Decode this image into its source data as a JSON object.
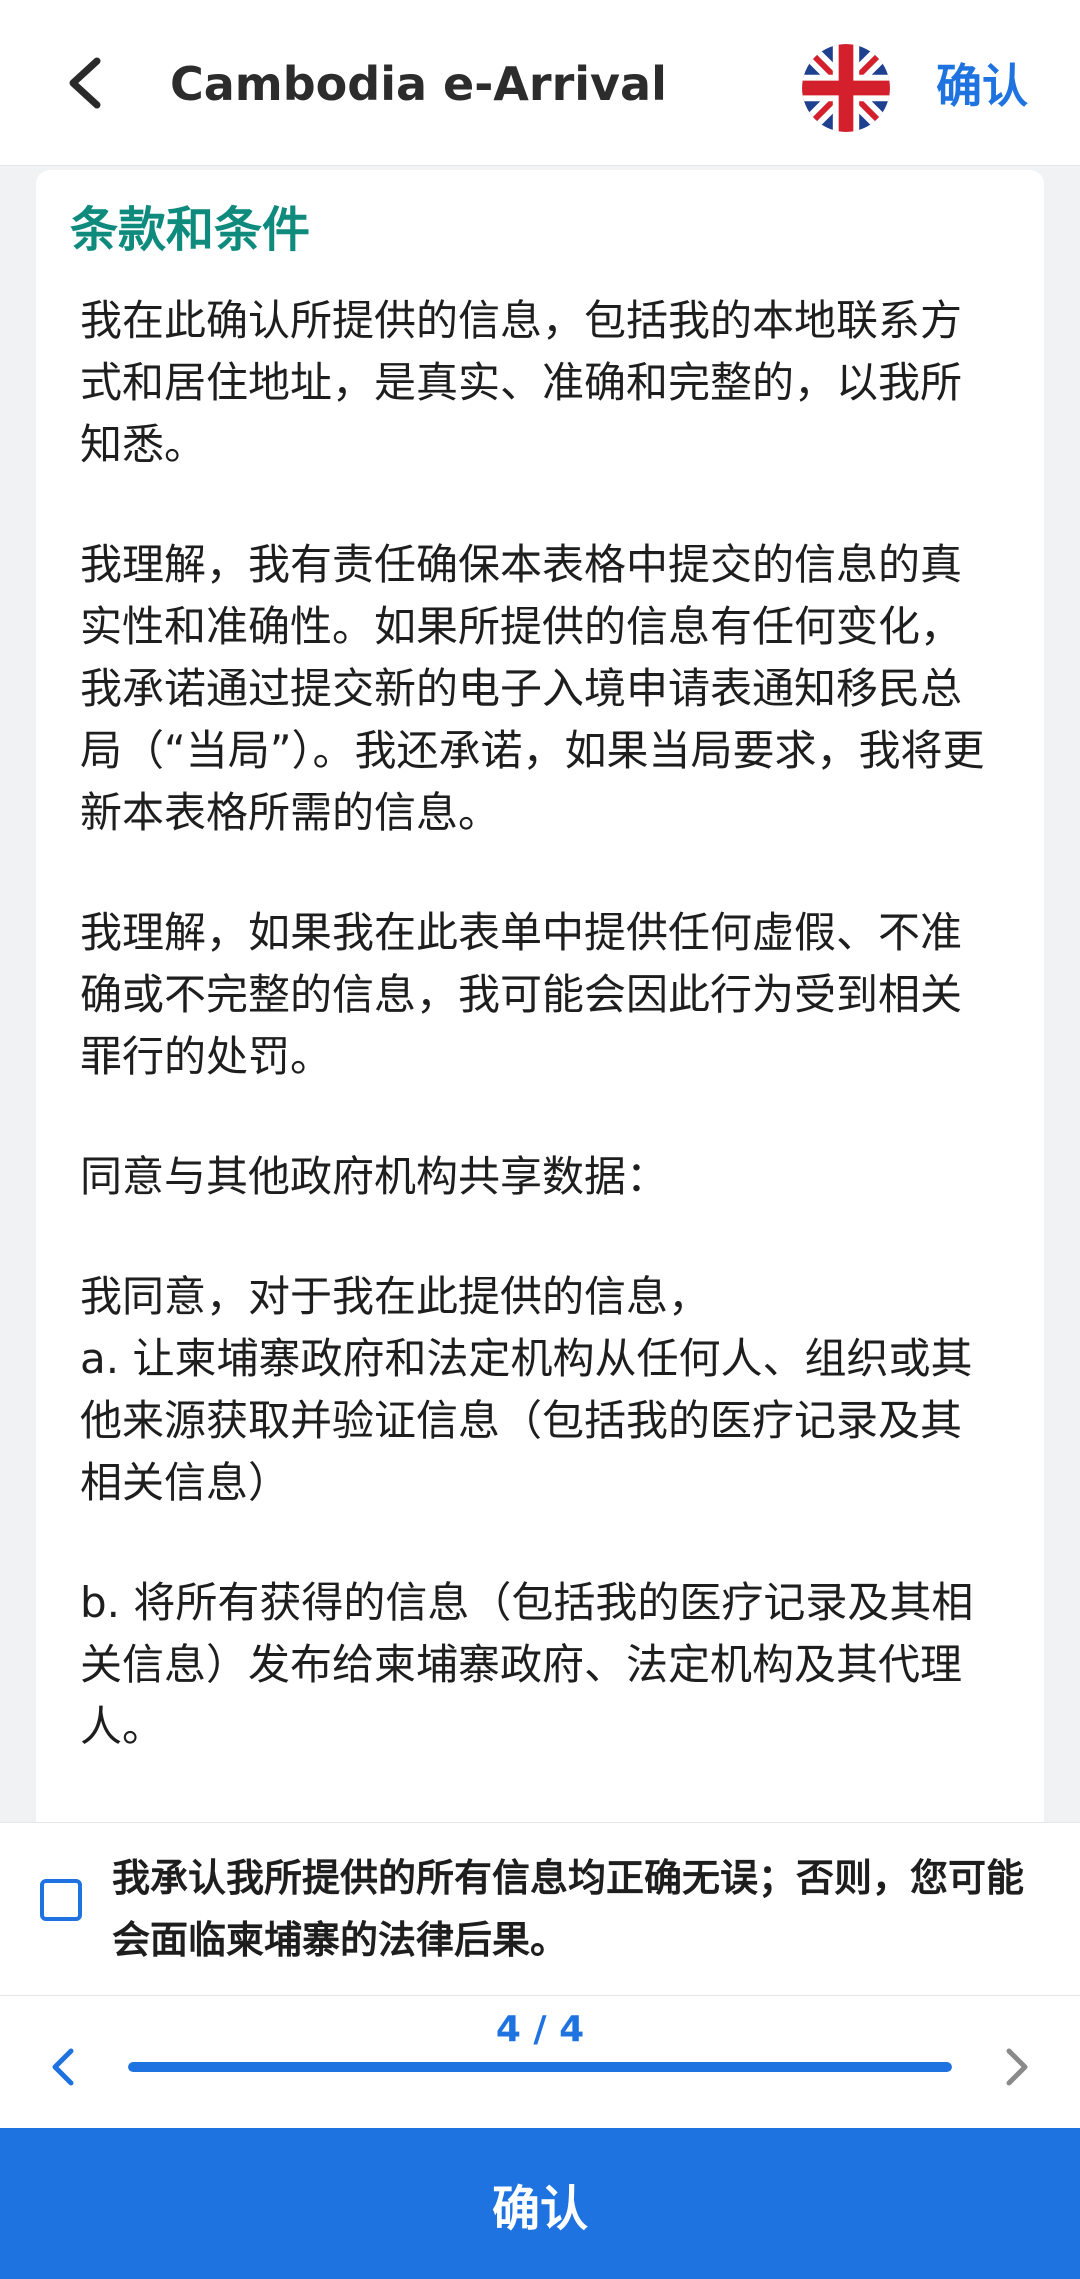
{
  "header": {
    "title": "Cambodia e-Arrival",
    "confirm_label": "确认",
    "language_flag": "uk-flag-icon"
  },
  "card": {
    "heading": "条款和条件",
    "paragraphs": [
      "我在此确认所提供的信息，包括我的本地联系方式和居住地址，是真实、准确和完整的，以我所知悉。",
      "我理解，我有责任确保本表格中提交的信息的真实性和准确性。如果所提供的信息有任何变化，我承诺通过提交新的电子入境申请表通知移民总局（“当局”）。我还承诺，如果当局要求，我将更新本表格所需的信息。",
      "我理解，如果我在此表单中提供任何虚假、不准确或不完整的信息，我可能会因此行为受到相关罪行的处罚。",
      "同意与其他政府机构共享数据：",
      "我同意，对于我在此提供的信息，\na. 让柬埔寨政府和法定机构从任何人、组织或其他来源获取并验证信息（包括我的医疗记录及其相关信息）",
      "b. 将所有获得的信息（包括我的医疗记录及其相关信息）发布给柬埔寨政府、法定机构及其代理人。"
    ]
  },
  "acknowledgement": {
    "checked": false,
    "text": "我承认我所提供的所有信息均正确无误；否则，您可能会面临柬埔寨的法律后果。"
  },
  "pager": {
    "label": "4 / 4",
    "current": 4,
    "total": 4,
    "progress": 1.0
  },
  "footer": {
    "confirm_label": "确认"
  },
  "colors": {
    "accent": "#1f73e0",
    "heading": "#0e8b7d"
  }
}
